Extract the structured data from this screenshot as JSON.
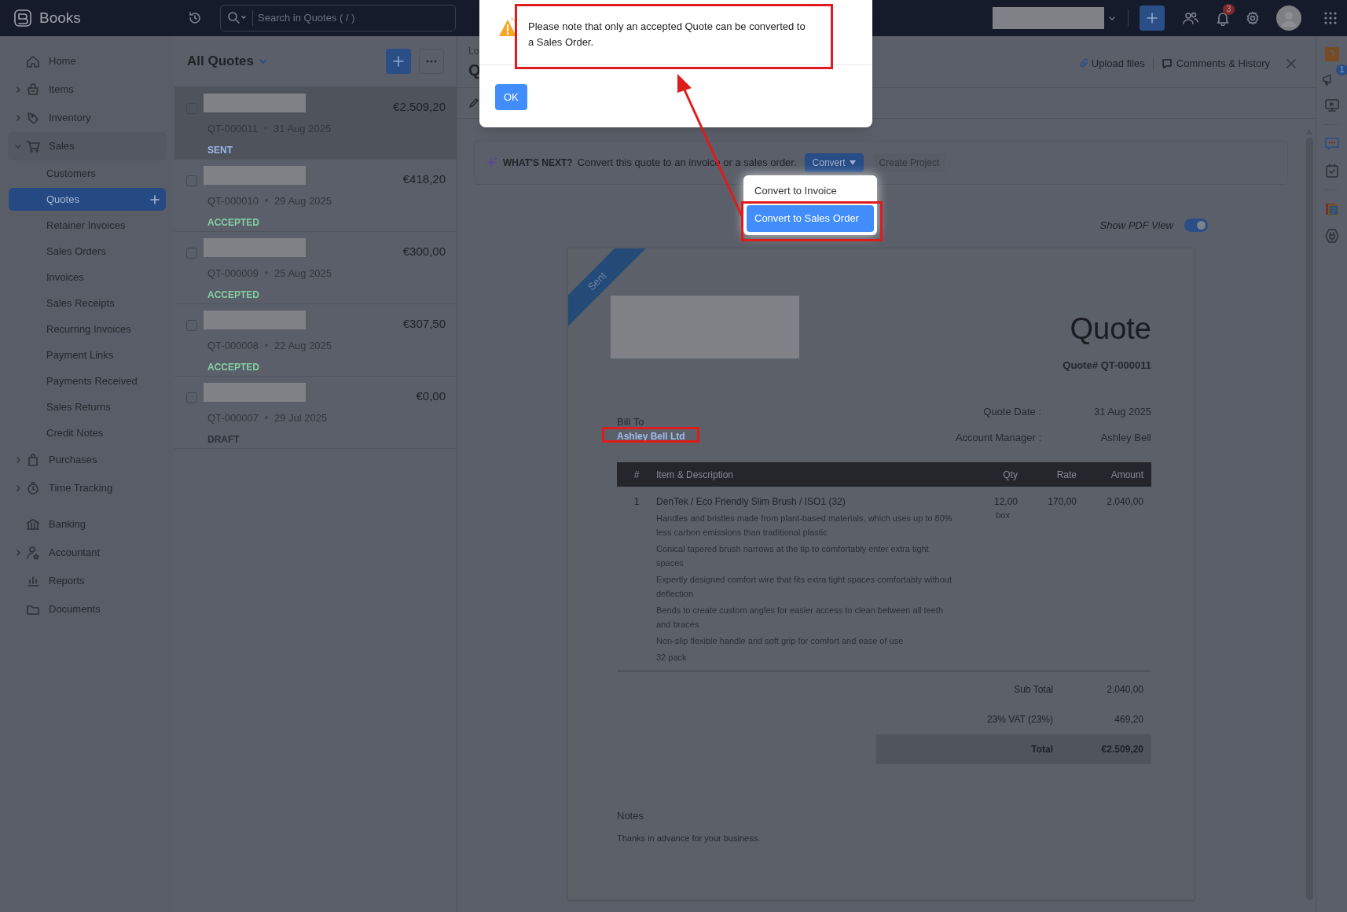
{
  "top_bar": {
    "app_name": "Books",
    "search": {
      "placeholder": "Search in Quotes ( / )"
    },
    "notification_count": "3"
  },
  "sidebar": {
    "items": [
      {
        "label": "Home"
      },
      {
        "label": "Items",
        "expanded": false
      },
      {
        "label": "Inventory",
        "expanded": false
      },
      {
        "label": "Sales",
        "expanded": true,
        "children": [
          {
            "label": "Customers",
            "selected": false
          },
          {
            "label": "Quotes",
            "selected": true
          },
          {
            "label": "Retainer Invoices",
            "selected": false
          },
          {
            "label": "Sales Orders",
            "selected": false
          },
          {
            "label": "Invoices",
            "selected": false
          },
          {
            "label": "Sales Receipts",
            "selected": false
          },
          {
            "label": "Recurring Invoices",
            "selected": false
          },
          {
            "label": "Payment Links",
            "selected": false
          },
          {
            "label": "Payments Received",
            "selected": false
          },
          {
            "label": "Sales Returns",
            "selected": false
          },
          {
            "label": "Credit Notes",
            "selected": false
          }
        ]
      },
      {
        "label": "Purchases",
        "expanded": false
      },
      {
        "label": "Time Tracking",
        "expanded": false
      },
      {
        "label": "Banking"
      },
      {
        "label": "Accountant",
        "expanded": false
      },
      {
        "label": "Reports"
      },
      {
        "label": "Documents"
      }
    ]
  },
  "quote_list": {
    "title": "All Quotes",
    "quotes": [
      {
        "number": "QT-000011",
        "date": "31 Aug 2025",
        "amount": "€2.509,20",
        "status": "SENT",
        "color": "#9bb6ea",
        "selected": true
      },
      {
        "number": "QT-000010",
        "date": "29 Aug 2025",
        "amount": "€418,20",
        "status": "ACCEPTED",
        "color": "#86cfa6",
        "selected": false
      },
      {
        "number": "QT-000009",
        "date": "25 Aug 2025",
        "amount": "€300,00",
        "status": "ACCEPTED",
        "color": "#86cfa6",
        "selected": false
      },
      {
        "number": "QT-000008",
        "date": "22 Aug 2025",
        "amount": "€307,50",
        "status": "ACCEPTED",
        "color": "#86cfa6",
        "selected": false
      },
      {
        "number": "QT-000007",
        "date": "29 Jul 2025",
        "amount": "€0,00",
        "status": "DRAFT",
        "color": "#2d3036",
        "selected": false
      }
    ]
  },
  "detail": {
    "breadcrumb": "Lo",
    "title": "Q",
    "actions": [
      "Upload files",
      "Comments & History"
    ],
    "whats_next": {
      "heading": "WHAT'S NEXT?",
      "text": "Convert this quote to an invoice or a sales order.",
      "convert_button": "Convert",
      "project_button": "Create Project"
    },
    "convert_menu": [
      {
        "label": "Convert to Invoice",
        "selected": false
      },
      {
        "label": "Convert to Sales Order",
        "selected": true
      }
    ],
    "pdf_toggle": {
      "label": "Show PDF View",
      "on": true
    },
    "document": {
      "ribbon": "Sent",
      "title": "Quote",
      "number_label": "Quote# QT-000011",
      "bill_to_label": "Bill To",
      "customer": "Ashley Bell Ltd",
      "fields": [
        {
          "label": "Quote Date :",
          "value": "31 Aug 2025"
        },
        {
          "label": "Account Manager :",
          "value": "Ashley Bell"
        }
      ],
      "columns": [
        "#",
        "Item & Description",
        "Qty",
        "Rate",
        "Amount"
      ],
      "lines": [
        {
          "index": "1",
          "name": "DenTek / Eco Friendly Slim Brush / ISO1 (32)",
          "description": [
            "Handles and bristles made from plant-based materials, which uses up to 80% less carbon emissions than traditional plastic",
            "Conical tapered brush narrows at the tip to comfortably enter extra tight spaces",
            "Expertly designed comfort wire that fits extra tight spaces comfortably without deflection",
            "Bends to create custom angles for easier access to clean between all teeth and braces",
            "Non-slip flexible handle and soft grip for comfort and ease of use",
            "32 pack"
          ],
          "qty": "12,00",
          "unit": "box",
          "rate": "170,00",
          "amount": "2.040,00"
        }
      ],
      "totals": [
        {
          "label": "Sub Total",
          "value": "2.040,00",
          "emphasis": false
        },
        {
          "label": "23% VAT (23%)",
          "value": "469,20",
          "emphasis": false
        },
        {
          "label": "Total",
          "value": "€2.509,20",
          "emphasis": true
        }
      ],
      "notes_label": "Notes",
      "notes": "Thanks in advance for your business."
    }
  },
  "modal": {
    "message": "Please note that only an accepted Quote can be converted to a Sales Order.",
    "ok": "OK"
  },
  "right_rail": {
    "badge": "1"
  }
}
